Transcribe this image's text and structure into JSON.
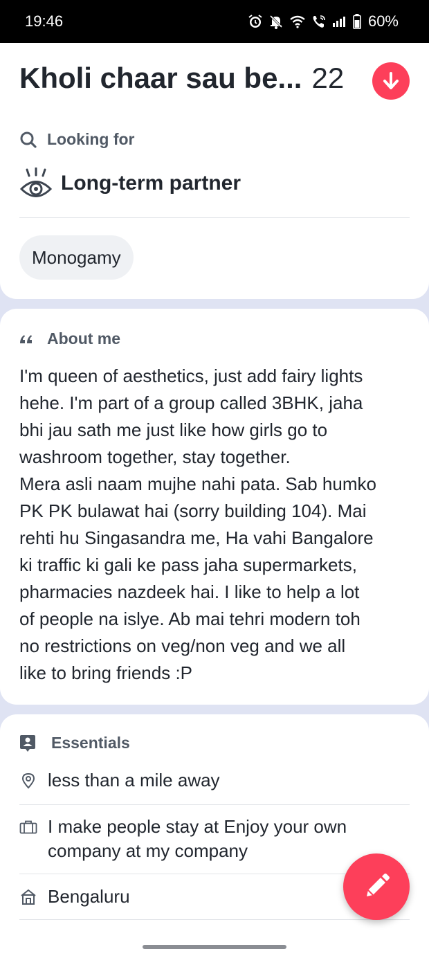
{
  "status_bar": {
    "time": "19:46",
    "battery": "60%",
    "icons": [
      "alarm-icon",
      "mute-icon",
      "wifi-icon",
      "wifi-call-icon",
      "signal-icon",
      "battery-icon"
    ]
  },
  "header": {
    "name": "Kholi chaar sau be...",
    "age": "22",
    "collapse_icon": "arrow-down-icon",
    "accent_color": "#fd3f5a"
  },
  "looking_for": {
    "heading": "Looking for",
    "heading_icon": "search-icon",
    "value": "Long-term partner",
    "value_icon": "eyes-icon",
    "tags": [
      "Monogamy"
    ]
  },
  "about_me": {
    "heading": "About me",
    "heading_icon": "quote-icon",
    "text": "I'm queen of aesthetics, just add fairy lights\nhehe. I'm part of a group called 3BHK, jaha\nbhi jau sath me just like how girls go to\nwashroom together, stay together.\nMera asli naam mujhe nahi pata. Sab humko\nPK PK bulawat hai (sorry building 104). Mai\nrehti hu Singasandra me, Ha vahi Bangalore\nki traffic ki gali ke pass jaha supermarkets,\npharmacies nazdeek hai. I like to help a lot\nof people na islye. Ab mai tehri modern toh\nno restrictions on veg/non veg and we all\nlike to bring friends :P"
  },
  "essentials": {
    "heading": "Essentials",
    "heading_icon": "person-card-icon",
    "items": [
      {
        "icon": "location-pin-icon",
        "text": "less than a mile away"
      },
      {
        "icon": "briefcase-icon",
        "text": "I make people stay at Enjoy your own\ncompany at my company"
      },
      {
        "icon": "home-icon",
        "text": "Bengaluru"
      }
    ]
  },
  "fab": {
    "icon": "pencil-icon"
  }
}
